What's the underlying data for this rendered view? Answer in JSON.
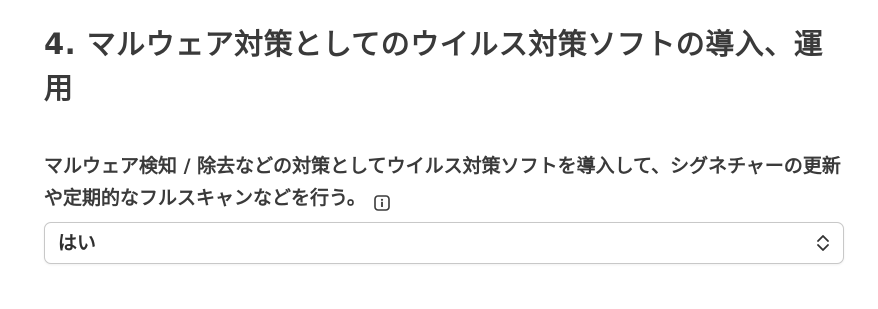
{
  "section": {
    "title": "4. マルウェア対策としてのウイルス対策ソフトの導入、運用"
  },
  "question": {
    "text": "マルウェア検知 / 除去などの対策としてウイルス対策ソフトを導入して、シグネチャーの更新や定期的なフルスキャンなどを行う。",
    "info_icon": "info-icon"
  },
  "answer_select": {
    "selected_value": "はい",
    "icon": "chevron-up-down-icon"
  }
}
